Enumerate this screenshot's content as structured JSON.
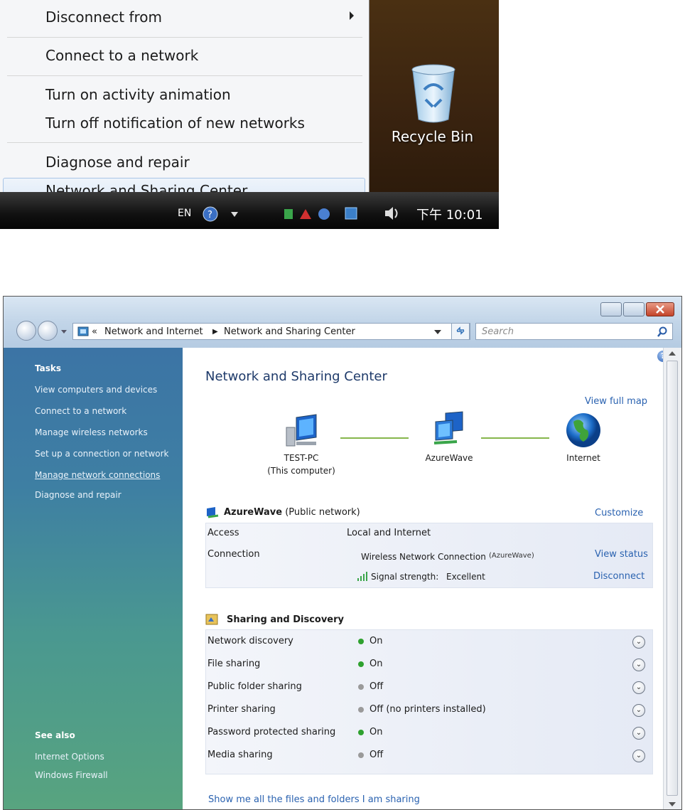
{
  "context_menu": {
    "items": [
      {
        "label": "Disconnect from"
      },
      {
        "label": "Connect to a network"
      },
      {
        "label": "Turn on activity animation"
      },
      {
        "label": "Turn off notification of new networks"
      },
      {
        "label": "Diagnose and repair"
      },
      {
        "label": "Network and Sharing Center"
      }
    ]
  },
  "desktop": {
    "recycle_bin_label": "Recycle Bin"
  },
  "taskbar": {
    "lang": "EN",
    "clock": "下午 10:01"
  },
  "window": {
    "address": {
      "crumb1": "Network and Internet",
      "crumb2": "Network and Sharing Center"
    },
    "search_placeholder": "Search",
    "sidebar": {
      "tasks_heading": "Tasks",
      "tasks": [
        "View computers and devices",
        "Connect to a network",
        "Manage wireless networks",
        "Set up a connection or network",
        "Manage network connections",
        "Diagnose and repair"
      ],
      "see_also_heading": "See also",
      "see_also": [
        "Internet Options",
        "Windows Firewall"
      ]
    },
    "content": {
      "title": "Network and Sharing Center",
      "view_full_map": "View full map",
      "map": {
        "computer_name": "TEST-PC",
        "computer_sub": "(This computer)",
        "network_name": "AzureWave",
        "internet_label": "Internet"
      },
      "network": {
        "name": "AzureWave",
        "type": "(Public network)",
        "customize": "Customize",
        "access_label": "Access",
        "access_value": "Local and Internet",
        "connection_label": "Connection",
        "connection_value": "Wireless Network Connection",
        "connection_ssid": "(AzureWave)",
        "view_status": "View status",
        "signal_label": "Signal strength:",
        "signal_value": "Excellent",
        "disconnect": "Disconnect"
      },
      "sharing": {
        "heading": "Sharing and Discovery",
        "rows": [
          {
            "label": "Network discovery",
            "value": "On",
            "state": "on"
          },
          {
            "label": "File sharing",
            "value": "On",
            "state": "on"
          },
          {
            "label": "Public folder sharing",
            "value": "Off",
            "state": "off"
          },
          {
            "label": "Printer sharing",
            "value": "Off (no printers installed)",
            "state": "off"
          },
          {
            "label": "Password protected sharing",
            "value": "On",
            "state": "on"
          },
          {
            "label": "Media sharing",
            "value": "Off",
            "state": "off"
          }
        ]
      },
      "show_files_link": "Show me all the files and folders I am sharing"
    }
  },
  "colors": {
    "on": "#2fa12f",
    "off": "#9a9a9a",
    "link": "#2a62b0"
  }
}
